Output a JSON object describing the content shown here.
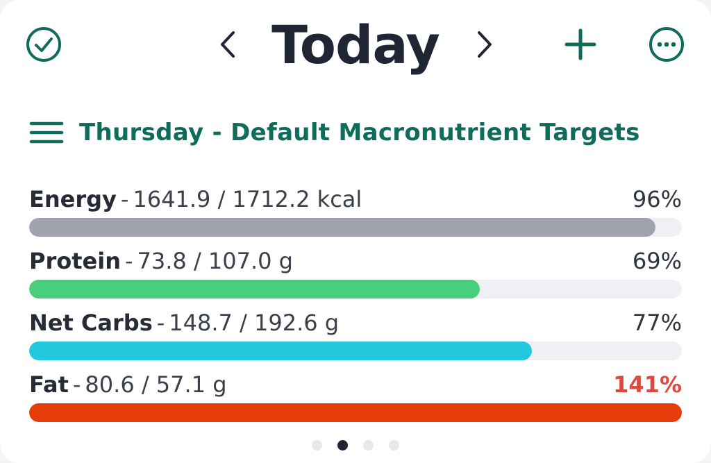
{
  "header": {
    "title": "Today",
    "icons": {
      "check": "check-circle-icon",
      "prev": "chevron-left-icon",
      "next": "chevron-right-icon",
      "add": "plus-icon",
      "more": "more-horizontal-icon"
    }
  },
  "subheader": {
    "menu_icon": "hamburger-menu-icon",
    "title": "Thursday - Default Macronutrient Targets"
  },
  "macros": [
    {
      "name": "Energy",
      "amounts": "1641.9 / 1712.2 kcal",
      "percent_label": "96%",
      "percent": 96,
      "color": "#9ea3ae",
      "over": false
    },
    {
      "name": "Protein",
      "amounts": "73.8 / 107.0 g",
      "percent_label": "69%",
      "percent": 69,
      "color": "#48cf7d",
      "over": false
    },
    {
      "name": "Net Carbs",
      "amounts": "148.7 / 192.6 g",
      "percent_label": "77%",
      "percent": 77,
      "color": "#22c9dc",
      "over": false
    },
    {
      "name": "Fat",
      "amounts": "80.6 / 57.1 g",
      "percent_label": "141%",
      "percent": 141,
      "color": "#e63c0a",
      "over": true
    }
  ],
  "pagination": {
    "count": 4,
    "active_index": 1
  },
  "colors": {
    "accent": "#0f6b5a",
    "title": "#1f2533",
    "over": "#e0483d"
  }
}
